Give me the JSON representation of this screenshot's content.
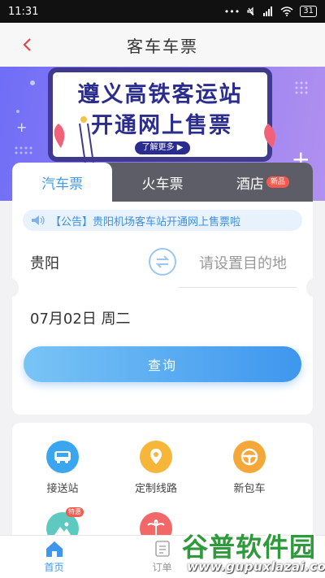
{
  "status_bar": {
    "time": "11:31",
    "battery": "31"
  },
  "header": {
    "title": "客车车票"
  },
  "banner": {
    "line1": "遵义高铁客运站",
    "line2": "开通网上售票",
    "more_label": "了解更多 ▶"
  },
  "tabs": [
    {
      "label": "汽车票",
      "active": true,
      "badge": ""
    },
    {
      "label": "火车票",
      "active": false,
      "badge": ""
    },
    {
      "label": "酒店",
      "active": false,
      "badge": "新品"
    }
  ],
  "notice": {
    "text": "【公告】贵阳机场客车站开通网上售票啦"
  },
  "route": {
    "from": "贵阳",
    "to_placeholder": "请设置目的地"
  },
  "date": {
    "text": "07月02日 周二"
  },
  "search": {
    "label": "查询"
  },
  "services": [
    {
      "label": "接送站",
      "icon": "bus-icon",
      "color": "#3aa6f0",
      "badge": ""
    },
    {
      "label": "定制线路",
      "icon": "route-pin-icon",
      "color": "#f5b63a",
      "badge": ""
    },
    {
      "label": "新包车",
      "icon": "steering-wheel-icon",
      "color": "#f5a73a",
      "badge": ""
    },
    {
      "label": "",
      "icon": "landscape-icon",
      "color": "#5dc9c0",
      "badge": "特惠"
    },
    {
      "label": "",
      "icon": "palm-tree-icon",
      "color": "#f26767",
      "badge": ""
    }
  ],
  "tabbar": [
    {
      "label": "首页",
      "icon": "home-icon",
      "active": true
    },
    {
      "label": "订单",
      "icon": "order-icon",
      "active": false
    }
  ],
  "watermark": {
    "title": "谷普软件园",
    "url": "www.gupuxlazai.com"
  },
  "colors": {
    "accent": "#3e96ee",
    "tab_bg": "#5d5d67",
    "banner": "#7a72f4"
  }
}
